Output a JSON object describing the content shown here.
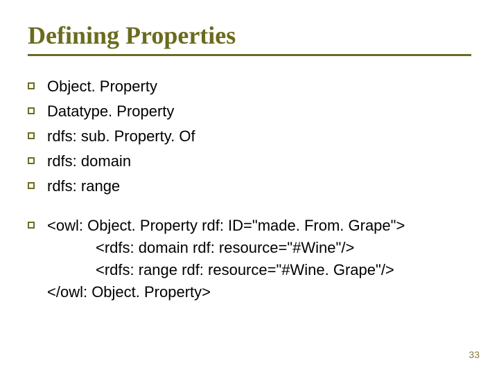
{
  "title": "Defining Properties",
  "bullets": [
    "Object. Property",
    "Datatype. Property",
    "rdfs: sub. Property. Of",
    "rdfs: domain",
    "rdfs: range"
  ],
  "code": {
    "line1": "<owl: Object. Property rdf: ID=\"made. From. Grape\">",
    "line2": "<rdfs: domain rdf: resource=\"#Wine\"/>",
    "line3": "<rdfs: range rdf: resource=\"#Wine. Grape\"/>",
    "line4": "</owl: Object. Property>"
  },
  "page_number": "33"
}
